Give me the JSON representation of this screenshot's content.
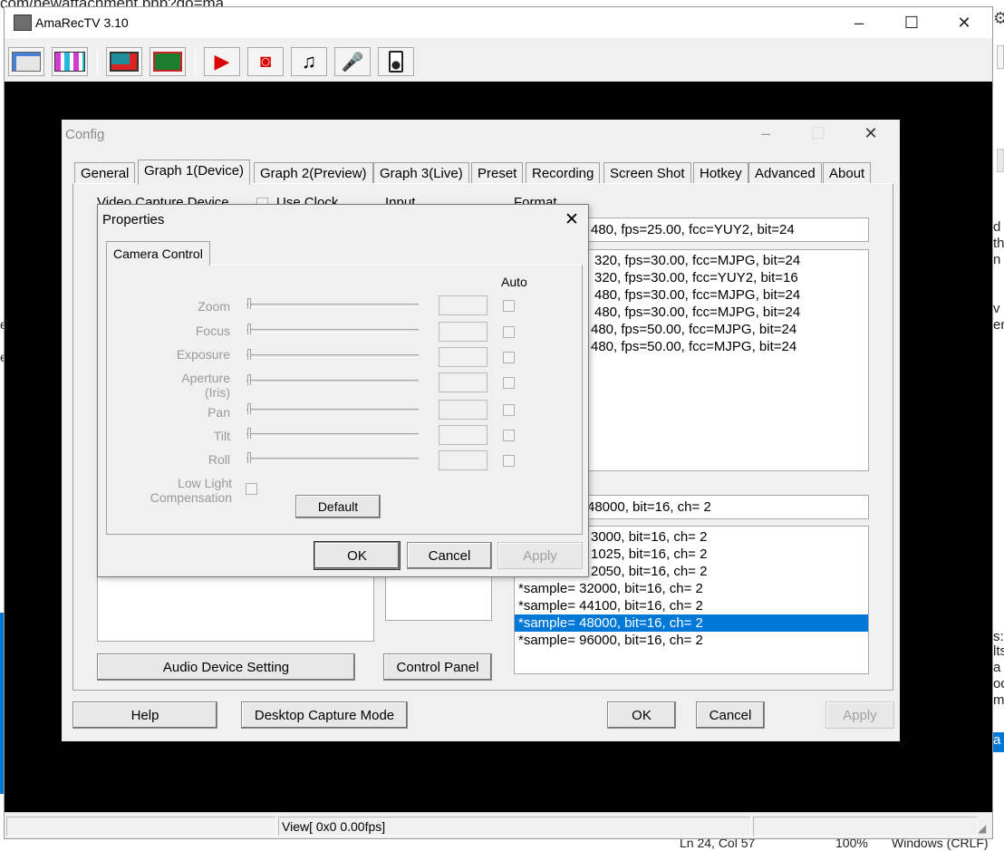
{
  "background": {
    "url_fragment": "com/newattachment.php?do=ma",
    "right_fragments": [
      "d",
      "th",
      "n",
      "v",
      "er",
      "s:",
      "lts",
      "a r",
      "od",
      "ma",
      "a"
    ],
    "left_fragments": [
      "e",
      "e"
    ],
    "editor_status": {
      "position": "Ln 24, Col 57",
      "zoom": "100%",
      "eol": "Windows (CRLF)"
    }
  },
  "app": {
    "title": "AmaRecTV 3.10",
    "status_text": "View[ 0x0 0.00fps]",
    "toolbar_icons": [
      "config-panel-icon",
      "graph-layout-icon",
      "monitor-icon",
      "capture-card-icon",
      "play-icon",
      "camera-icon",
      "music-note-icon",
      "microphone-icon",
      "speaker-icon"
    ]
  },
  "config": {
    "title": "Config",
    "tabs": [
      "General",
      "Graph 1(Device)",
      "Graph 2(Preview)",
      "Graph 3(Live)",
      "Preset",
      "Recording",
      "Screen Shot",
      "Hotkey",
      "Advanced",
      "About"
    ],
    "selected_tab": "Graph 1(Device)",
    "labels": {
      "video_capture_device": "Video Capture Device",
      "use_clock": "Use Clock",
      "input": "Input",
      "format": "Format"
    },
    "video_format_current": "480, fps=25.00,  fcc=YUY2, bit=24",
    "video_formats": [
      "320, fps=30.00,  fcc=MJPG, bit=24",
      "320, fps=30.00,  fcc=YUY2, bit=16",
      "480, fps=30.00,  fcc=MJPG, bit=24",
      "480, fps=30.00,  fcc=MJPG, bit=24",
      "480, fps=50.00,  fcc=MJPG, bit=24",
      "480, fps=50.00,  fcc=MJPG, bit=24"
    ],
    "audio_format_current": "48000, bit=16, ch= 2",
    "audio_formats": [
      "8000, bit=16, ch= 2",
      "11025, bit=16, ch= 2",
      "22050, bit=16, ch= 2",
      "*sample= 32000, bit=16, ch= 2",
      "*sample= 44100, bit=16, ch= 2",
      "*sample= 48000, bit=16, ch= 2",
      "*sample= 96000, bit=16, ch= 2"
    ],
    "audio_formats_clipped": [
      "3000, bit=16, ch= 2",
      "1025, bit=16, ch= 2",
      "2050, bit=16, ch= 2"
    ],
    "selected_audio_index": 5,
    "buttons": {
      "audio_device_setting": "Audio Device Setting",
      "control_panel": "Control Panel",
      "help": "Help",
      "desktop_capture": "Desktop Capture Mode",
      "ok": "OK",
      "cancel": "Cancel",
      "apply": "Apply"
    }
  },
  "properties": {
    "title": "Properties",
    "tab": "Camera Control",
    "auto_header": "Auto",
    "controls": [
      "Zoom",
      "Focus",
      "Exposure",
      "Aperture\n(Iris)",
      "Pan",
      "Tilt",
      "Roll"
    ],
    "low_light": "Low Light\nCompensation",
    "buttons": {
      "default": "Default",
      "ok": "OK",
      "cancel": "Cancel",
      "apply": "Apply"
    }
  }
}
